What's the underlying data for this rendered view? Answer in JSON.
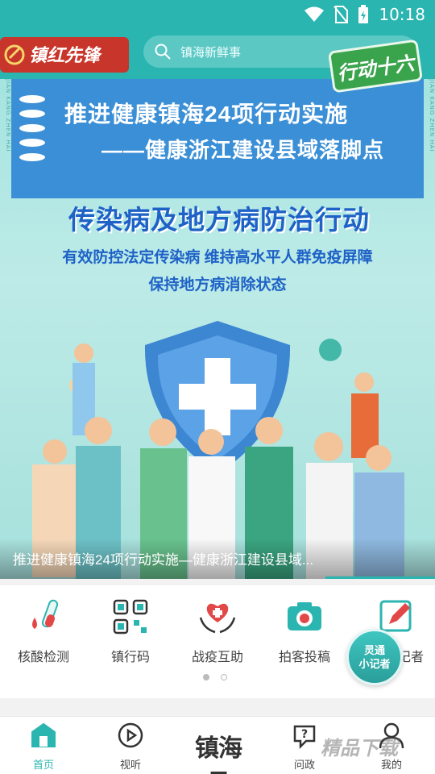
{
  "status_bar": {
    "time": "10:18"
  },
  "header": {
    "logo_text": "镇红先锋",
    "search_placeholder": "镇海新鲜事"
  },
  "banner": {
    "badge": "行动十六",
    "headline": "推进健康镇海24项行动实施",
    "subheadline": "——健康浙江建设县域落脚点",
    "main_title": "传染病及地方病防治行动",
    "slogan_line1": "有效防控法定传染病 维持高水平人群免疫屏障",
    "slogan_line2": "保持地方病消除状态",
    "side_text": "JIAN KANG ZHEN HAI",
    "caption": "推进健康镇海24项行动实施—健康浙江建设县域..."
  },
  "quick_actions": [
    {
      "label": "核酸检测",
      "icon": "test-tube-icon"
    },
    {
      "label": "镇行码",
      "icon": "qr-code-icon"
    },
    {
      "label": "战疫互助",
      "icon": "heart-hands-icon"
    },
    {
      "label": "拍客投稿",
      "icon": "camera-icon"
    },
    {
      "label": "记者",
      "icon": "edit-icon"
    }
  ],
  "reporter_fab": {
    "line1": "灵通",
    "line2": "小记者"
  },
  "nav": {
    "items": [
      {
        "label": "首页",
        "icon": "home-icon",
        "active": true
      },
      {
        "label": "视听",
        "icon": "play-icon",
        "active": false
      },
      {
        "label": "镇海号",
        "icon": "",
        "active": false
      },
      {
        "label": "问政",
        "icon": "question-icon",
        "active": false
      },
      {
        "label": "我的",
        "icon": "user-icon",
        "active": false
      }
    ]
  },
  "watermark": "精品下载",
  "colors": {
    "accent": "#2ab5b0",
    "banner_blue": "#3b8fd6",
    "title_blue": "#1e62c7"
  }
}
